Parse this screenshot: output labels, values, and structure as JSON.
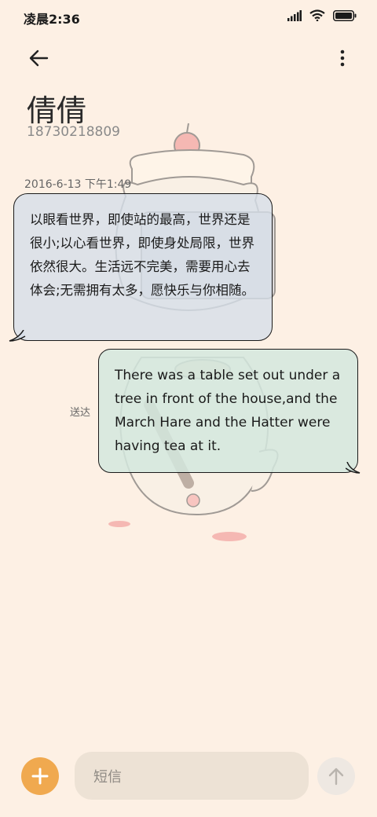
{
  "status_bar": {
    "time": "凌晨2:36"
  },
  "contact": {
    "name": "倩倩",
    "number": "18730218809"
  },
  "conversation": {
    "date_stamp": "2016-6-13 下午1:49",
    "received_message": "以眼看世界，即使站的最高，世界还是很小;以心看世界，即使身处局限，世界依然很大。生活远不完美，需要用心去体会;无需拥有太多，愿快乐与你相随。",
    "sent_message": "There was a table set out under a tree in front of the house,and the March Hare and the Hatter were having tea at it.",
    "sent_status": "送达"
  },
  "composer": {
    "placeholder": "短信"
  },
  "colors": {
    "background": "#fdf0e4",
    "accent": "#f0a94f",
    "received_bubble": "#d6dee8",
    "sent_bubble": "#d4e8de"
  }
}
